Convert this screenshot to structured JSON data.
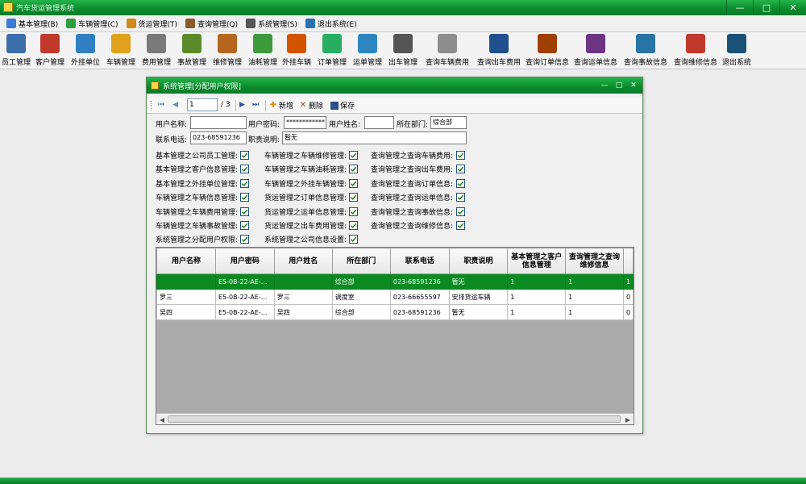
{
  "app": {
    "title": "汽车货运管理系统"
  },
  "window_buttons": [
    "—",
    "□",
    "✕"
  ],
  "menu": [
    {
      "label": "基本管理(B)",
      "icon": "people-icon",
      "color": "#3a7bd5"
    },
    {
      "label": "车辆管理(C)",
      "icon": "car-icon",
      "color": "#2e9e3e"
    },
    {
      "label": "货运管理(T)",
      "icon": "tools-icon",
      "color": "#d08a1a"
    },
    {
      "label": "查询管理(Q)",
      "icon": "query-icon",
      "color": "#8a5a2b"
    },
    {
      "label": "系统管理(S)",
      "icon": "system-icon",
      "color": "#555555"
    },
    {
      "label": "退出系统(E)",
      "icon": "exit-icon",
      "color": "#2a6fb0"
    }
  ],
  "toolbar": [
    {
      "label": "员工管理",
      "icon": "employee-icon",
      "color": "#3b6ea8"
    },
    {
      "label": "客户管理",
      "icon": "customer-icon",
      "color": "#c0392b"
    },
    {
      "label": "外挂单位",
      "icon": "house-icon",
      "color": "#2f7fc1"
    },
    {
      "label": "车辆管理",
      "icon": "truck-icon",
      "color": "#e0a21c"
    },
    {
      "label": "费用管理",
      "icon": "expense-icon",
      "color": "#7a7a7a"
    },
    {
      "label": "事故管理",
      "icon": "accident-icon",
      "color": "#5a8a2a"
    },
    {
      "label": "维修管理",
      "icon": "repair-icon",
      "color": "#b5651d"
    },
    {
      "label": "油耗管理",
      "icon": "fuel-icon",
      "color": "#3c9a3c"
    },
    {
      "label": "外挂车辆",
      "icon": "external-truck-icon",
      "color": "#d35400"
    },
    {
      "label": "订单管理",
      "icon": "order-icon",
      "color": "#27ae60"
    },
    {
      "label": "运单管理",
      "icon": "waybill-icon",
      "color": "#2e86c1"
    },
    {
      "label": "出车管理",
      "icon": "dispatch-icon",
      "color": "#555555"
    },
    {
      "label": "查询车辆费用",
      "icon": "search-vehicle-fee-icon",
      "color": "#8e8e8e"
    },
    {
      "label": "查询出车费用",
      "icon": "search-dispatch-fee-icon",
      "color": "#1f4f8f"
    },
    {
      "label": "查询订单信息",
      "icon": "search-order-icon",
      "color": "#a04000"
    },
    {
      "label": "查询运单信息",
      "icon": "search-waybill-icon",
      "color": "#6c3483"
    },
    {
      "label": "查询事故信息",
      "icon": "search-accident-icon",
      "color": "#2874a6"
    },
    {
      "label": "查询维修信息",
      "icon": "search-repair-icon",
      "color": "#c0392b"
    },
    {
      "label": "退出系统",
      "icon": "exit-door-icon",
      "color": "#1a5276"
    }
  ],
  "dialog": {
    "title": "系统管理[分配用户权限]",
    "nav": {
      "first": "⏮",
      "prev": "◀",
      "position": "1",
      "total": "/ 3",
      "next": "▶",
      "last": "⏭",
      "add_label": "新增",
      "delete_label": "删除",
      "save_label": "保存"
    },
    "form": {
      "username_label": "用户名称:",
      "username_value": "",
      "password_label": "用户密码:",
      "password_value": "************",
      "realname_label": "用户姓名:",
      "realname_value": "",
      "dept_label": "所在部门:",
      "dept_value": "综合部",
      "phone_label": "联系电话:",
      "phone_value": "023-68591236",
      "duty_label": "职责说明:",
      "duty_value": "暂无"
    },
    "permissions": [
      [
        "基本管理之公司员工管理:",
        "车辆管理之车辆维修管理:",
        "查询管理之查询车辆费用:"
      ],
      [
        "基本管理之客户信息管理:",
        "车辆管理之车辆油耗管理:",
        "查询管理之查询出车费用:"
      ],
      [
        "基本管理之外挂单位管理:",
        "车辆管理之外挂车辆管理:",
        "查询管理之查询订单信息:"
      ],
      [
        "车辆管理之车辆信息管理:",
        "货运管理之订单信息管理:",
        "查询管理之查询运单信息:"
      ],
      [
        "车辆管理之车辆费用管理:",
        "货运管理之运单信息管理:",
        "查询管理之查询事故信息:"
      ],
      [
        "车辆管理之车辆事故管理:",
        "货运管理之出车费用管理:",
        "查询管理之查询维修信息:"
      ],
      [
        "系统管理之分配用户权限:",
        "系统管理之公司信息设置:"
      ]
    ],
    "grid": {
      "columns": [
        "用户名称",
        "用户密码",
        "用户姓名",
        "所在部门",
        "联系电话",
        "职责说明",
        "基本管理之客户信息管理",
        "查询管理之查询维修信息"
      ],
      "rows": [
        [
          "",
          "E5-0B-22-AE-...",
          "",
          "综合部",
          "023-68591236",
          "暂无",
          "1",
          "1",
          "1"
        ],
        [
          "罗三",
          "E5-0B-22-AE-...",
          "罗三",
          "调度室",
          "023-66655597",
          "安排货运车辆",
          "1",
          "1",
          "0"
        ],
        [
          "吴四",
          "E5-0B-22-AE-...",
          "吴四",
          "综合部",
          "023-68591236",
          "暂无",
          "1",
          "1",
          "0"
        ]
      ],
      "selected_row": 0
    }
  }
}
